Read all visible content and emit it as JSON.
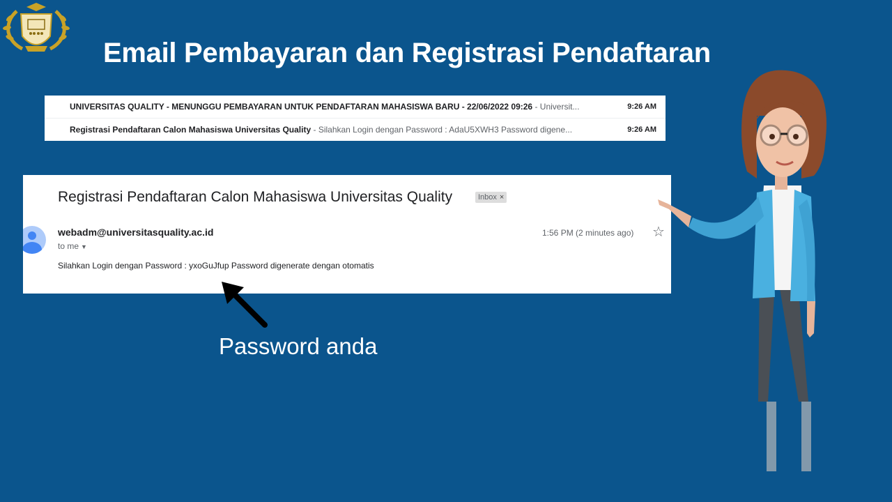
{
  "slide": {
    "title": "Email Pembayaran dan Registrasi Pendaftaran"
  },
  "inbox_list": [
    {
      "subject": "UNIVERSITAS QUALITY - MENUNGGU PEMBAYARAN UNTUK PENDAFTARAN MAHASISWA BARU - 22/06/2022 09:26",
      "snippet": "Universit...",
      "time": "9:26 AM"
    },
    {
      "subject": "Registrasi Pendaftaran Calon Mahasiswa Universitas Quality",
      "snippet": "Silahkan Login dengan Password : AdaU5XWH3 Password digene...",
      "time": "9:26 AM"
    }
  ],
  "email": {
    "subject": "Registrasi Pendaftaran Calon Mahasiswa Universitas Quality",
    "badge": "Inbox",
    "badge_close": "×",
    "sender": "webadm@universitasquality.ac.id",
    "recipient": "to me",
    "time": "1:56 PM (2 minutes ago)",
    "body": "Silahkan Login dengan Password : yxoGuJfup Password digenerate dengan otomatis"
  },
  "callout": "Password anda",
  "icons": {
    "star": "☆",
    "caret": "▼",
    "logo": "university-crest",
    "avatar": "person-avatar"
  },
  "colors": {
    "background": "#0b558d",
    "avatar": "#4285f4",
    "badge": "#dddddd"
  }
}
